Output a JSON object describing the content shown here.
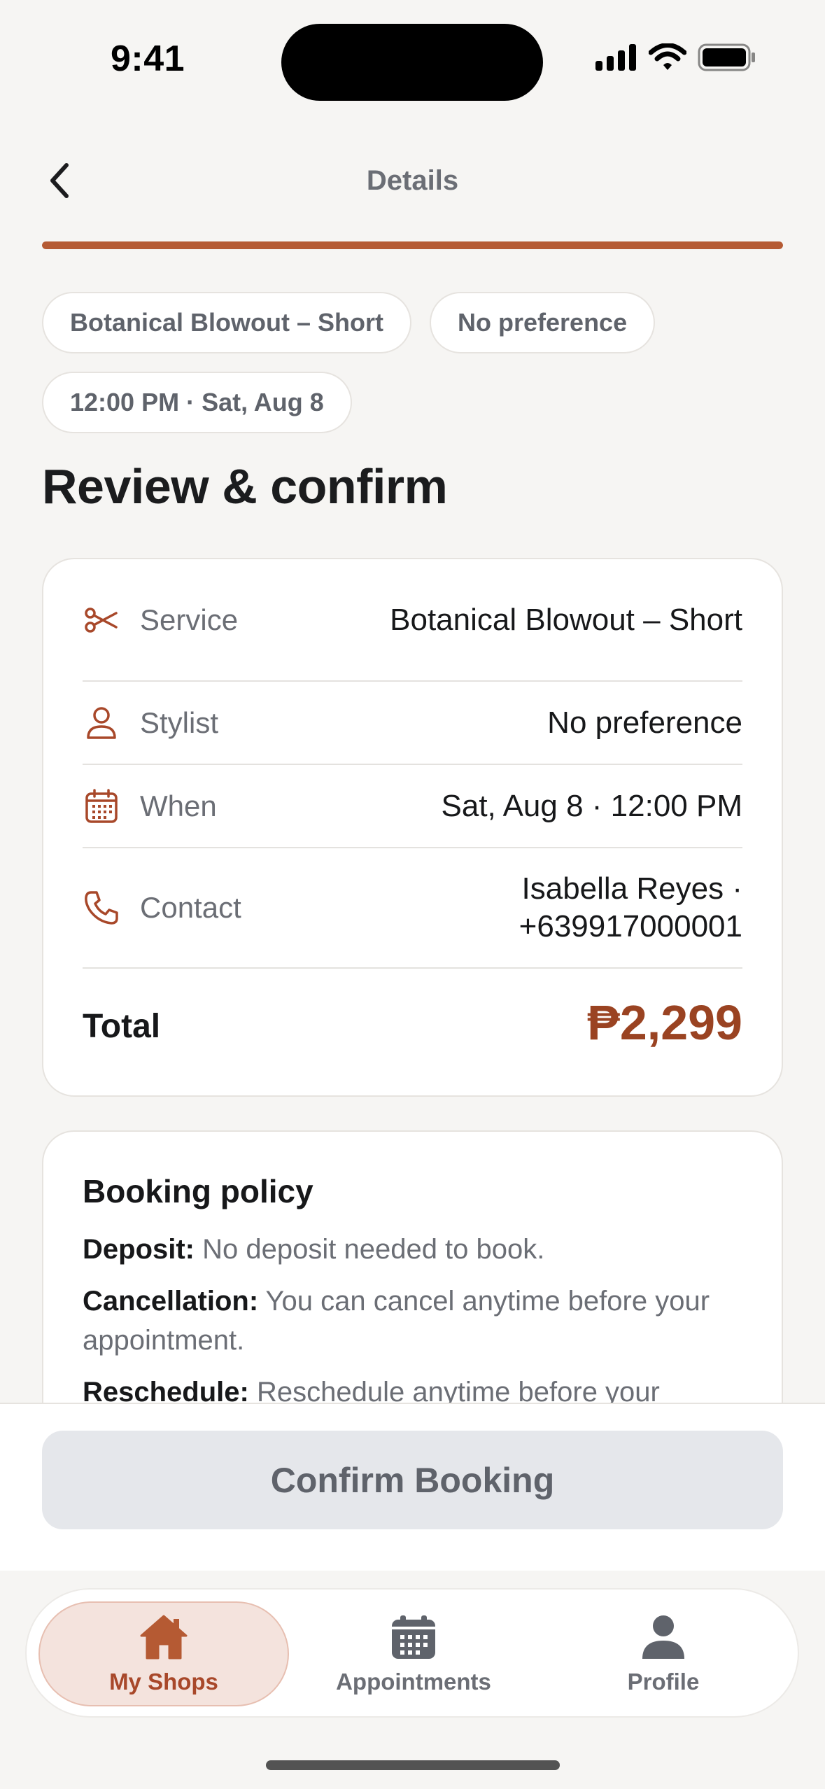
{
  "status_bar": {
    "time": "9:41"
  },
  "header": {
    "title": "Details"
  },
  "progress": {
    "fraction": 1.0
  },
  "chips": [
    {
      "label": "Botanical Blowout – Short"
    },
    {
      "label": "No preference"
    },
    {
      "label": "12:00 PM · Sat, Aug 8"
    }
  ],
  "page_title": "Review & confirm",
  "summary": {
    "service": {
      "label": "Service",
      "value": "Botanical Blowout – Short",
      "icon": "scissors-icon"
    },
    "stylist": {
      "label": "Stylist",
      "value": "No preference",
      "icon": "person-icon"
    },
    "when": {
      "label": "When",
      "value": "Sat, Aug 8 · 12:00 PM",
      "icon": "calendar-icon"
    },
    "contact": {
      "label": "Contact",
      "value_line1": "Isabella Reyes ·",
      "value_line2": "+639917000001",
      "icon": "phone-icon"
    },
    "total": {
      "label": "Total",
      "value": "₱2,299"
    }
  },
  "policy": {
    "title": "Booking policy",
    "items": [
      {
        "term": "Deposit:",
        "text": "No deposit needed to book."
      },
      {
        "term": "Cancellation:",
        "text": "You can cancel anytime before your appointment."
      },
      {
        "term": "Reschedule:",
        "text": "Reschedule anytime before your"
      }
    ]
  },
  "confirm_button": {
    "label": "Confirm Booking"
  },
  "tab_bar": {
    "tabs": [
      {
        "label": "My Shops",
        "icon": "house-icon",
        "active": true
      },
      {
        "label": "Appointments",
        "icon": "calendar-icon",
        "active": false
      },
      {
        "label": "Profile",
        "icon": "person-icon",
        "active": false
      }
    ]
  },
  "colors": {
    "accent": "#b55a33",
    "price": "#9a4322",
    "active_tab_bg": "#f4e3dd",
    "muted_text": "#6b6e75"
  }
}
